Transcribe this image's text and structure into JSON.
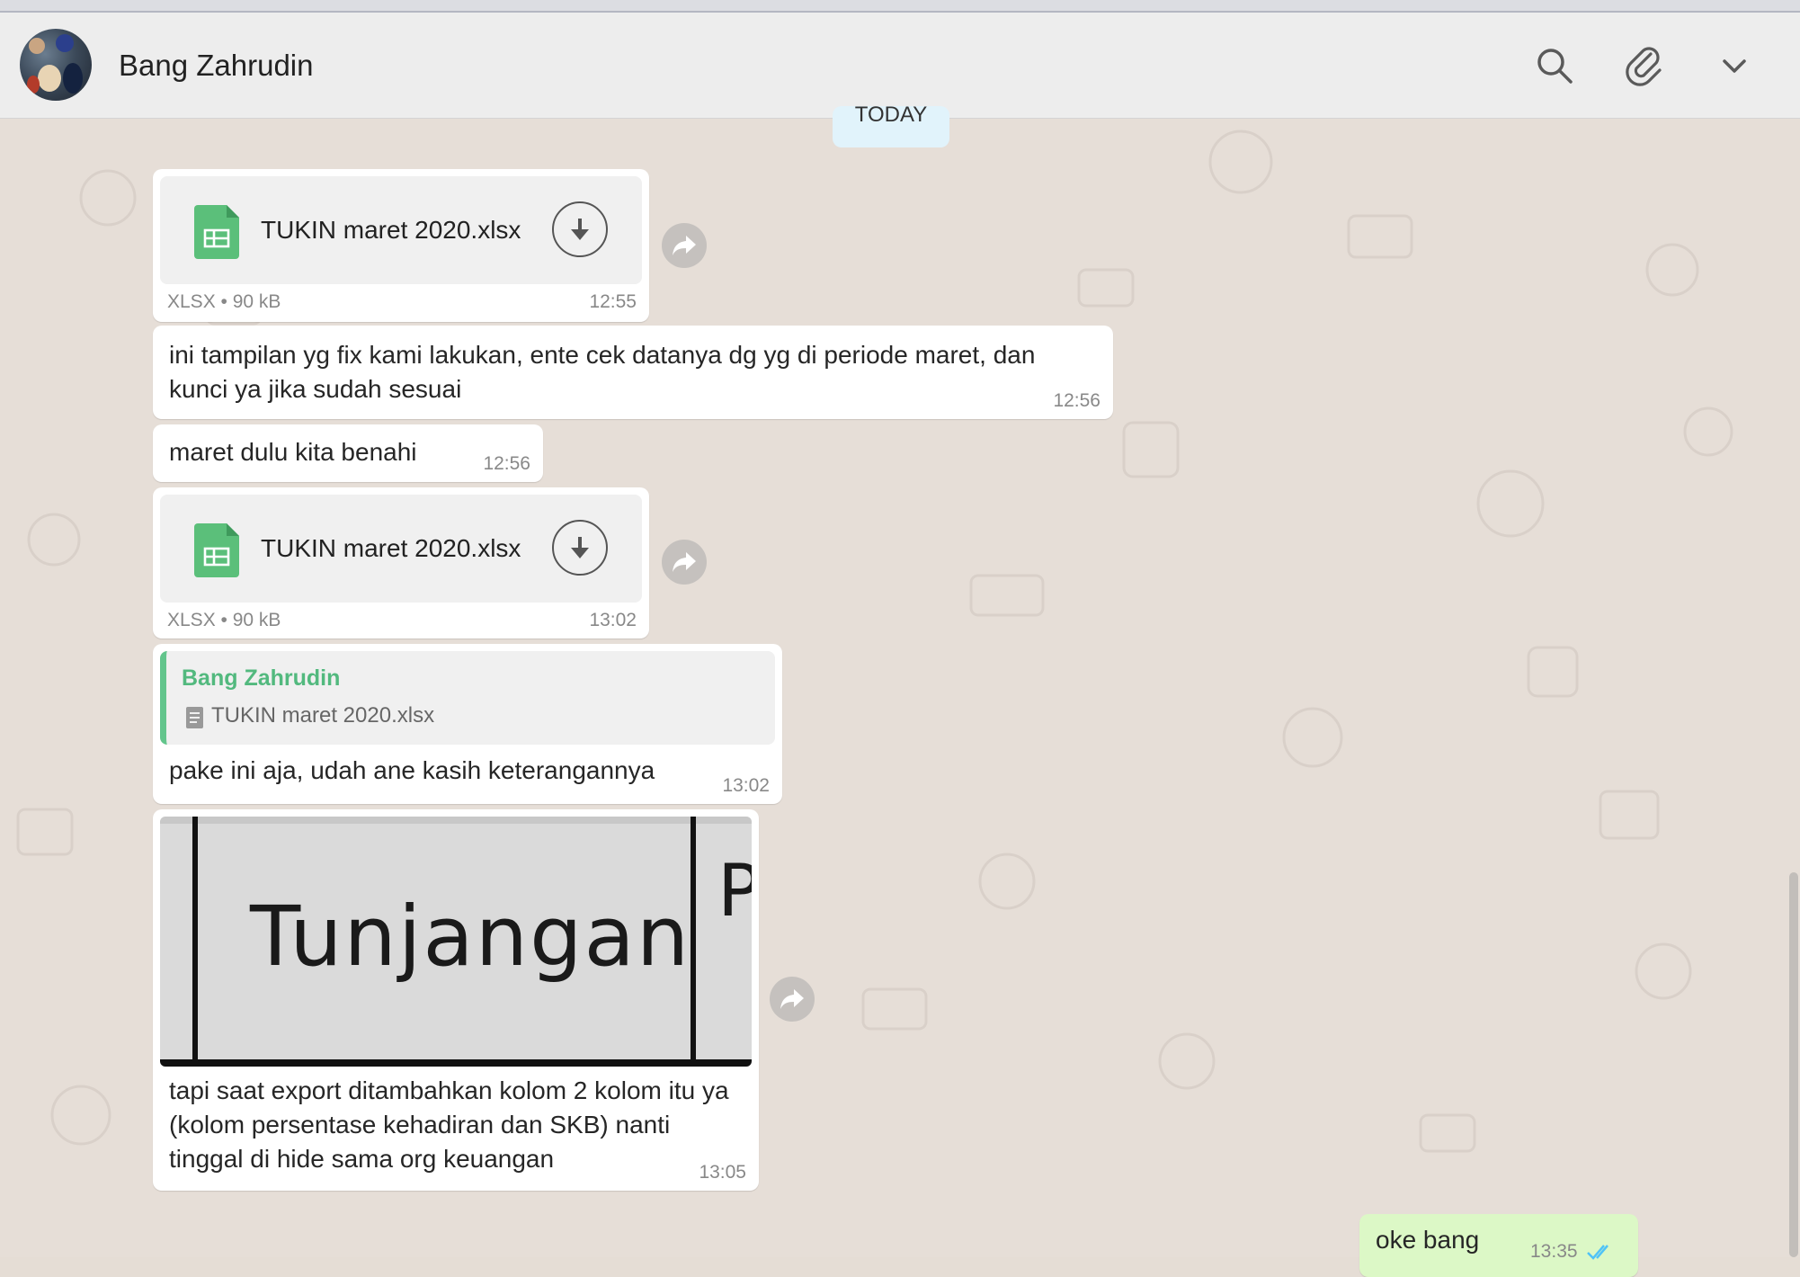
{
  "header": {
    "contact_name": "Bang Zahrudin"
  },
  "icons": {
    "search": "search-icon",
    "attach": "paperclip-icon",
    "menu": "chevron-down-icon"
  },
  "date_chip": "TODAY",
  "messages": [
    {
      "type": "file",
      "filename": "TUKIN maret 2020.xlsx",
      "meta": "XLSX • 90 kB",
      "time": "12:55"
    },
    {
      "type": "text",
      "text": "ini tampilan yg fix kami lakukan, ente cek datanya dg yg di periode maret, dan kunci ya jika sudah sesuai",
      "time": "12:56"
    },
    {
      "type": "text",
      "text": "maret dulu kita benahi",
      "time": "12:56"
    },
    {
      "type": "file",
      "filename": "TUKIN maret 2020.xlsx",
      "meta": "XLSX • 90 kB",
      "time": "13:02"
    },
    {
      "type": "reply",
      "quote_author": "Bang Zahrudin",
      "quote_text": "TUKIN maret 2020.xlsx",
      "text": "pake ini aja, udah ane kasih keterangannya",
      "time": "13:02"
    },
    {
      "type": "image",
      "image_text": "Tunjangan",
      "image_text_partial": "P",
      "text": "tapi saat export ditambahkan kolom 2 kolom itu ya (kolom persentase kehadiran dan SKB) nanti tinggal di hide sama org keuangan",
      "time": "13:05"
    },
    {
      "type": "outgoing",
      "text": "oke bang",
      "time": "13:35",
      "status": "read"
    }
  ],
  "colors": {
    "chat_background": "#e6ded7",
    "incoming_bubble": "#ffffff",
    "outgoing_bubble": "#dcf8c6",
    "sheet_green": "#5bbf7a",
    "quote_accent": "#52b97e",
    "read_tick": "#4fc3f7"
  }
}
